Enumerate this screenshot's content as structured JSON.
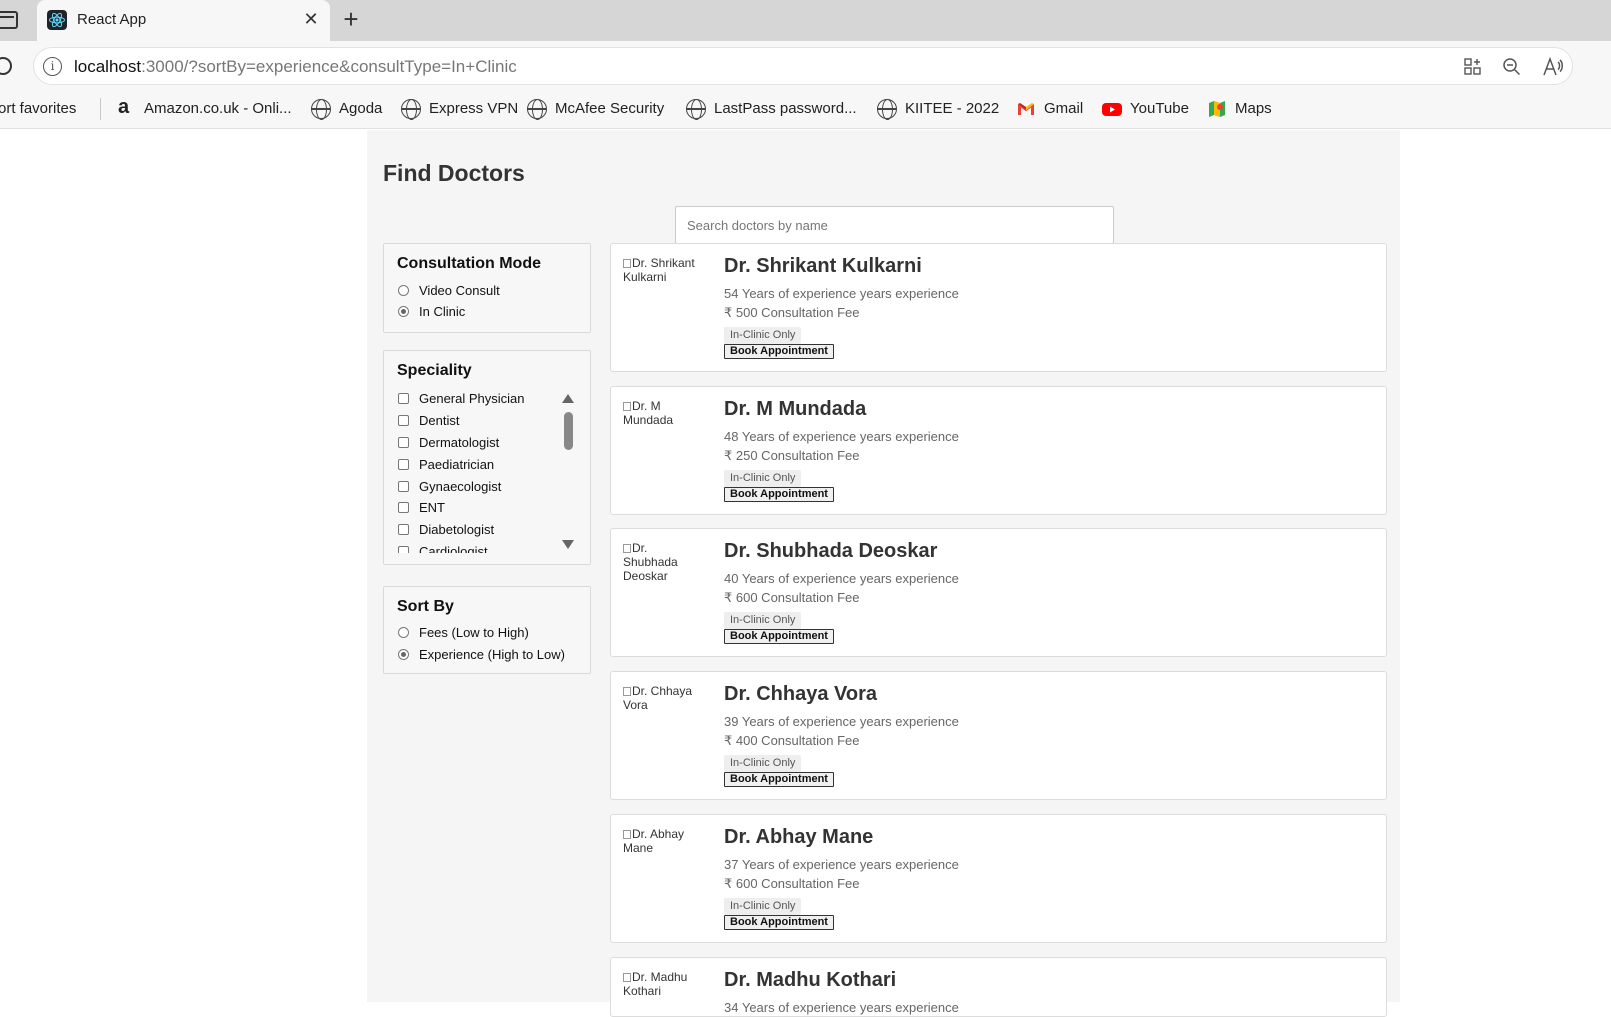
{
  "browser": {
    "tab_title": "React App",
    "url_host": "localhost",
    "url_rest": ":3000/?sortBy=experience&consultType=In+Clinic",
    "favorites": [
      {
        "label": "ort favorites",
        "icon": "none"
      },
      {
        "label": "Amazon.co.uk - Onli...",
        "icon": "amazon-icon"
      },
      {
        "label": "Agoda",
        "icon": "globe-icon"
      },
      {
        "label": "Express VPN",
        "icon": "globe-icon"
      },
      {
        "label": "McAfee Security",
        "icon": "globe-icon"
      },
      {
        "label": "LastPass password...",
        "icon": "globe-icon"
      },
      {
        "label": "KIITEE - 2022",
        "icon": "globe-icon"
      },
      {
        "label": "Gmail",
        "icon": "gmail-icon"
      },
      {
        "label": "YouTube",
        "icon": "youtube-icon"
      },
      {
        "label": "Maps",
        "icon": "maps-icon"
      }
    ]
  },
  "page": {
    "title": "Find Doctors",
    "search_placeholder": "Search doctors by name"
  },
  "filters": {
    "consultation_mode": {
      "title": "Consultation Mode",
      "options": [
        {
          "label": "Video Consult",
          "selected": false
        },
        {
          "label": "In Clinic",
          "selected": true
        }
      ]
    },
    "speciality": {
      "title": "Speciality",
      "options": [
        "General Physician",
        "Dentist",
        "Dermatologist",
        "Paediatrician",
        "Gynaecologist",
        "ENT",
        "Diabetologist",
        "Cardiologist"
      ]
    },
    "sort_by": {
      "title": "Sort By",
      "options": [
        {
          "label": "Fees (Low to High)",
          "selected": false
        },
        {
          "label": "Experience (High to Low)",
          "selected": true
        }
      ]
    }
  },
  "doctors": [
    {
      "photo_alt_1": "Dr. Shrikant",
      "photo_alt_2": "Kulkarni",
      "name": "Dr. Shrikant Kulkarni",
      "experience": "54 Years of experience years experience",
      "fee": "₹ 500 Consultation Fee",
      "tag": "In-Clinic Only",
      "book": "Book Appointment"
    },
    {
      "photo_alt_1": "Dr. M",
      "photo_alt_2": "Mundada",
      "name": "Dr. M Mundada",
      "experience": "48 Years of experience years experience",
      "fee": "₹ 250 Consultation Fee",
      "tag": "In-Clinic Only",
      "book": "Book Appointment"
    },
    {
      "photo_alt_1": "Dr.",
      "photo_alt_2": "Shubhada Deoskar",
      "name": "Dr. Shubhada Deoskar",
      "experience": "40 Years of experience years experience",
      "fee": "₹ 600 Consultation Fee",
      "tag": "In-Clinic Only",
      "book": "Book Appointment"
    },
    {
      "photo_alt_1": "Dr. Chhaya",
      "photo_alt_2": "Vora",
      "name": "Dr. Chhaya Vora",
      "experience": "39 Years of experience years experience",
      "fee": "₹ 400 Consultation Fee",
      "tag": "In-Clinic Only",
      "book": "Book Appointment"
    },
    {
      "photo_alt_1": "Dr. Abhay",
      "photo_alt_2": "Mane",
      "name": "Dr. Abhay Mane",
      "experience": "37 Years of experience years experience",
      "fee": "₹ 600 Consultation Fee",
      "tag": "In-Clinic Only",
      "book": "Book Appointment"
    },
    {
      "photo_alt_1": "Dr. Madhu",
      "photo_alt_2": "Kothari",
      "name": "Dr. Madhu Kothari",
      "experience": "34 Years of experience years experience",
      "fee": "",
      "tag": "",
      "book": ""
    }
  ]
}
